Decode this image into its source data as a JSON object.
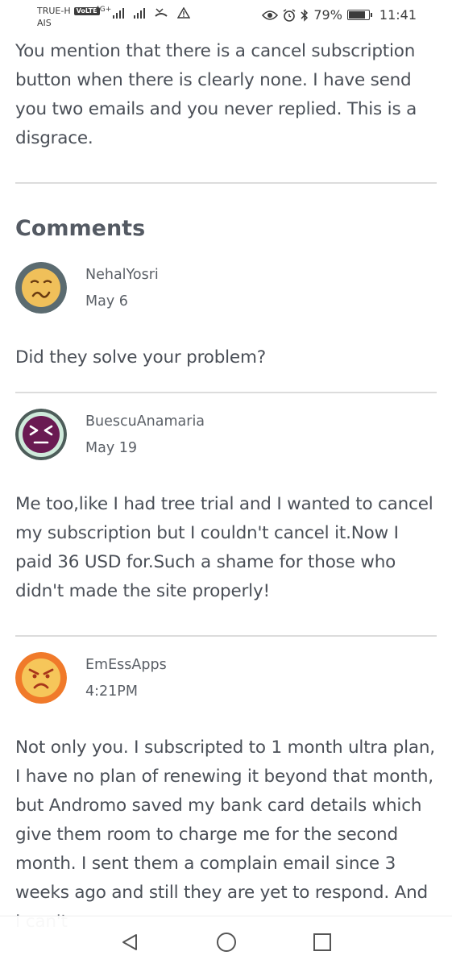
{
  "status_bar": {
    "carrier_line1": "TRUE-H",
    "volte_label": "VoLTE",
    "carrier_line2": "AIS",
    "network_label": "4G+",
    "battery_percent": "79%",
    "battery_level": 0.79,
    "time": "11:41",
    "icons": [
      "signal-icon",
      "missed-call-icon",
      "warning-icon",
      "eye-icon",
      "alarm-icon",
      "bluetooth-icon",
      "battery-icon"
    ]
  },
  "post": {
    "text": "You mention that there is a cancel subscription button when there is clearly none. I have send you two emails and you never replied. This is a disgrace."
  },
  "comments_heading": "Comments",
  "comments": [
    {
      "author": "NehalYosri",
      "date": "May 6",
      "text": "Did they solve your problem?",
      "avatar": "worried-face-icon",
      "avatar_bg": "#5b6b70",
      "avatar_face": "#f0c05a"
    },
    {
      "author": "BuescuAnamaria",
      "date": "May 19",
      "text": "Me too,like I had tree trial and I wanted to cancel my subscription but I couldn't cancel it.Now I paid 36 USD for.Such a shame for those who didn't made the site properly!",
      "avatar": "squinting-face-icon",
      "avatar_bg": "#cfeadb",
      "avatar_face": "#6a1a52"
    },
    {
      "author": "EmEssApps",
      "date": "4:21PM",
      "text": "Not only you. I subscripted to 1 month ultra plan, I have no plan of renewing it beyond that month, but Andromo saved my bank card details which give them room to charge me for the second month. I sent them a complain email since 3 weeks ago and still they are yet to respond. And I can't",
      "avatar": "angry-face-icon",
      "avatar_bg": "#f07a2a",
      "avatar_face": "#f6c65a"
    }
  ],
  "nav": {
    "back": "back-icon",
    "home": "home-icon",
    "recents": "recents-icon"
  }
}
